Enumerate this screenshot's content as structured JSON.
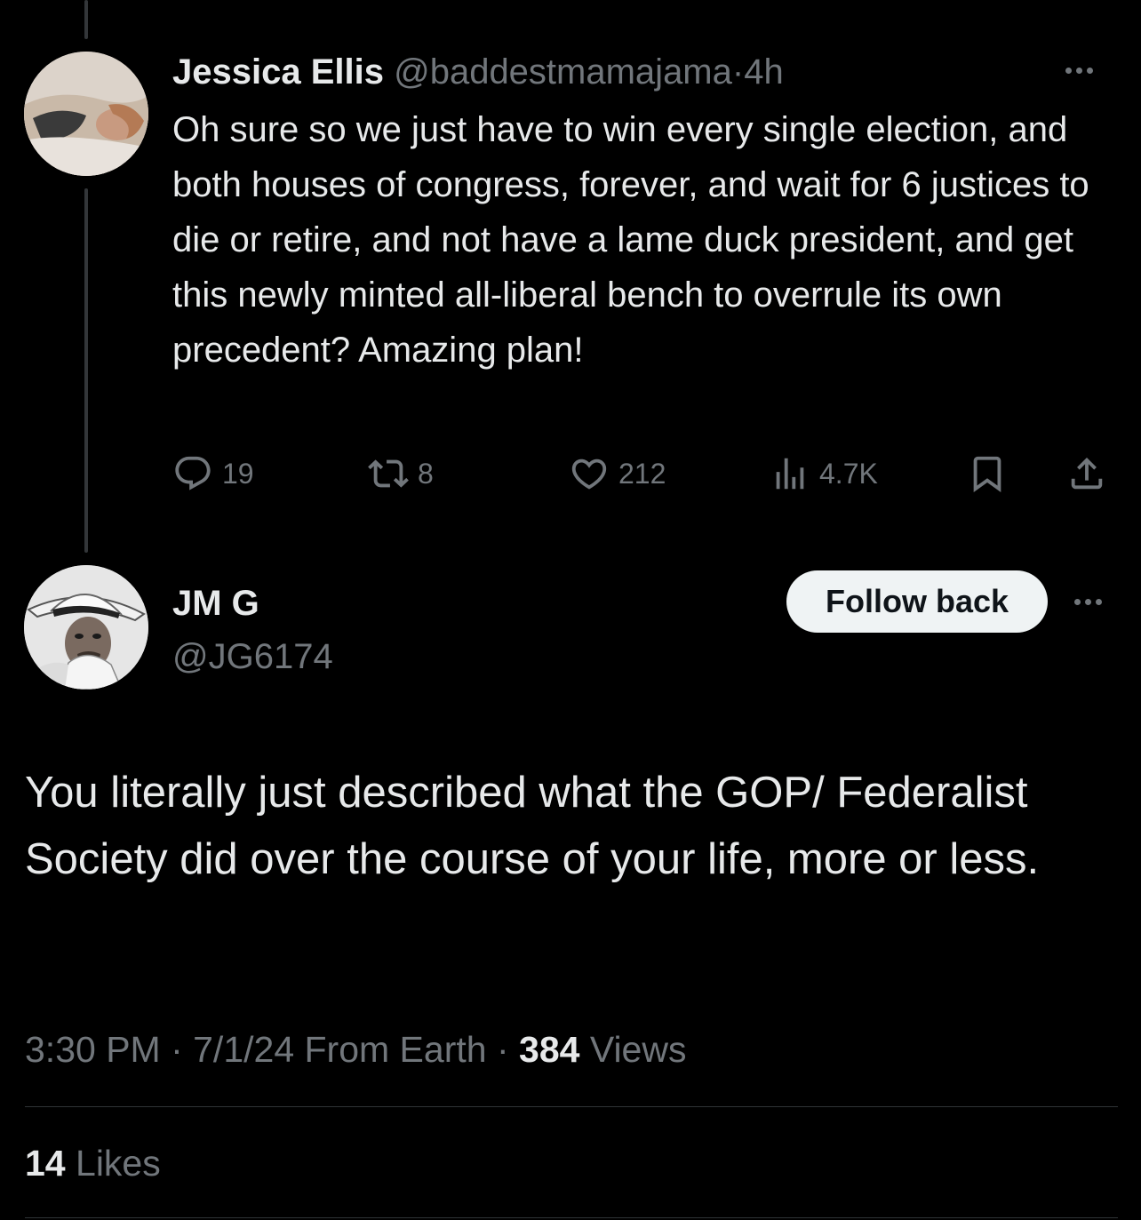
{
  "parent_tweet": {
    "author_name": "Jessica Ellis",
    "author_handle": "@baddestmamajama",
    "separator": "·",
    "time_ago": "4h",
    "text": "Oh sure so we just have to win every single election, and both houses of congress, forever, and wait for 6 justices to die or retire, and not have a lame duck president, and get this newly minted all-liberal bench to overrule its own precedent? Amazing plan!",
    "actions": {
      "replies": "19",
      "reposts": "8",
      "likes": "212",
      "views": "4.7K"
    },
    "icons": [
      "reply-icon",
      "repost-icon",
      "like-icon",
      "views-icon",
      "bookmark-icon",
      "share-icon",
      "more-icon"
    ]
  },
  "reply_tweet": {
    "author_name": "JM G",
    "author_handle": "@JG6174",
    "follow_button_label": "Follow back",
    "text": "You literally just described what the GOP/ Federalist Society did over the course of your life, more or less.",
    "timestamp": "3:30 PM · 7/1/24 From Earth",
    "separator": "·",
    "views_count": "384",
    "views_label": "Views",
    "likes_count": "14",
    "likes_label": "Likes"
  },
  "colors": {
    "background": "#000000",
    "primary_text": "#e7e9ea",
    "secondary_text": "#71767b",
    "divider": "#2f3336",
    "button_bg": "#eff3f4"
  }
}
